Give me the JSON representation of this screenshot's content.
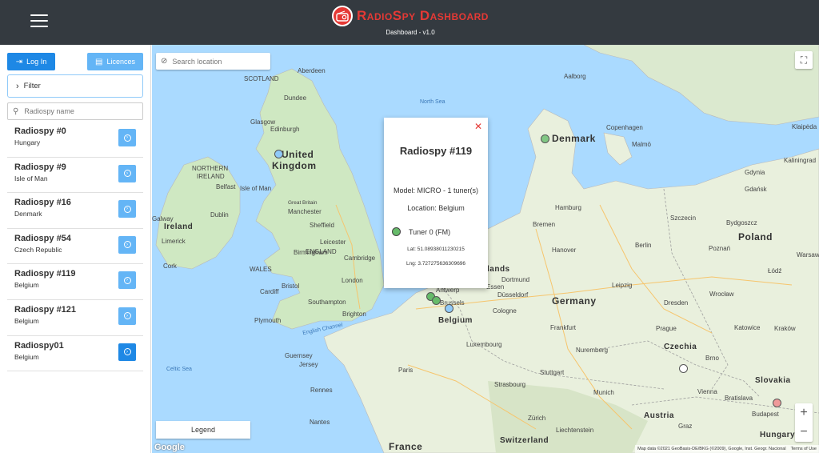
{
  "header": {
    "title": "RadioSpy Dashboard",
    "subtitle": "Dashboard - v1.0"
  },
  "sidebar": {
    "login_label": "Log In",
    "licences_label": "Licences",
    "filter_label": "Filter",
    "search_placeholder": "Radiospy name",
    "items": [
      {
        "name": "Radiospy #0",
        "country": "Hungary"
      },
      {
        "name": "Radiospy #9",
        "country": "Isle of Man"
      },
      {
        "name": "Radiospy #16",
        "country": "Denmark"
      },
      {
        "name": "Radiospy #54",
        "country": "Czech Republic"
      },
      {
        "name": "Radiospy #119",
        "country": "Belgium"
      },
      {
        "name": "Radiospy #121",
        "country": "Belgium"
      },
      {
        "name": "Radiospy01",
        "country": "Belgium"
      }
    ]
  },
  "map": {
    "search_placeholder": "Search location",
    "legend_label": "Legend",
    "google_label": "Google",
    "attribution": "Map data ©2021 GeoBasis-DE/BKG (©2009), Google, Inst. Geogr. Nacional",
    "terms": "Terms of Use",
    "zoom_in": "+",
    "zoom_out": "−",
    "countries": {
      "uk1": "United",
      "uk2": "Kingdom",
      "denmark": "Denmark",
      "germany": "Germany",
      "poland": "Poland",
      "czechia": "Czechia",
      "belgium": "Belgium",
      "france": "France",
      "switzerland": "Switzerland",
      "austria": "Austria",
      "slovakia": "Slovakia",
      "hungary": "Hungary",
      "ireland": "Ireland",
      "netherlands": "lands"
    },
    "seas": {
      "north_sea": "North Sea",
      "celtic_sea": "Celtic Sea",
      "english_channel": "English Channel"
    },
    "cities": {
      "scotland": "SCOTLAND",
      "aberdeen": "Aberdeen",
      "dundee": "Dundee",
      "glasgow": "Glasgow",
      "edinburgh": "Edinburgh",
      "northern_ireland1": "NORTHERN",
      "northern_ireland2": "IRELAND",
      "belfast": "Belfast",
      "isle_of_man": "Isle of Man",
      "galway": "Galway",
      "dublin": "Dublin",
      "limerick": "Limerick",
      "cork": "Cork",
      "great_britain": "Great Britain",
      "manchester": "Manchester",
      "sheffield": "Sheffield",
      "leicester": "Leicester",
      "birmingham": "Birmingham",
      "england": "ENGLAND",
      "cambridge": "Cambridge",
      "wales": "WALES",
      "cardiff": "Cardiff",
      "bristol": "Bristol",
      "london": "London",
      "southampton": "Southampton",
      "brighton": "Brighton",
      "plymouth": "Plymouth",
      "guernsey": "Guernsey",
      "jersey": "Jersey",
      "copenhagen": "Copenhagen",
      "aalborg": "Aalborg",
      "malmo": "Malmö",
      "hamburg": "Hamburg",
      "bremen": "Bremen",
      "hanover": "Hanover",
      "berlin": "Berlin",
      "szczecin": "Szczecin",
      "gdansk": "Gdańsk",
      "gdynia": "Gdynia",
      "bydgoszcz": "Bydgoszcz",
      "poznan": "Poznań",
      "warsaw": "Warsaw",
      "lodz": "Łódź",
      "wroclaw": "Wrocław",
      "leipzig": "Leipzig",
      "dresden": "Dresden",
      "dortmund": "Dortmund",
      "dusseldorf": "Düsseldorf",
      "cologne": "Cologne",
      "antwerp": "Antwerp",
      "brussels": "Brussels",
      "essen": "Essen",
      "frankfurt": "Frankfurt",
      "luxembourg": "Luxembourg",
      "nuremberg": "Nuremberg",
      "prague": "Prague",
      "katowice": "Katowice",
      "krakow": "Kraków",
      "brno": "Brno",
      "stuttgart": "Stuttgart",
      "munich": "Munich",
      "strasbourg": "Strasbourg",
      "vienna": "Vienna",
      "bratislava": "Bratislava",
      "budapest": "Budapest",
      "paris": "Paris",
      "nantes": "Nantes",
      "zurich": "Zürich",
      "liechtenstein": "Liechtenstein",
      "rennes": "Rennes",
      "graz": "Graz",
      "klaipeda": "Klaipėda",
      "kaliningrad": "Kaliningrad"
    },
    "markers": [
      {
        "id": "isle-of-man",
        "color": "#90caf9"
      },
      {
        "id": "denmark",
        "color": "#81c784"
      },
      {
        "id": "belgium-1",
        "color": "#66bb6a"
      },
      {
        "id": "belgium-2",
        "color": "#66bb6a"
      },
      {
        "id": "belgium-3",
        "color": "#90caf9"
      },
      {
        "id": "czechia",
        "color": "#ffffff"
      },
      {
        "id": "hungary",
        "color": "#ef9a9a"
      }
    ]
  },
  "popup": {
    "title": "Radiospy #119",
    "model": "Model: MICRO - 1 tuner(s)",
    "location": "Location: Belgium",
    "tuner": "Tuner 0 (FM)",
    "lat": "Lat: 51.089380112302​15",
    "lng": "Lng: 3.727275636309696",
    "close": "✕"
  }
}
